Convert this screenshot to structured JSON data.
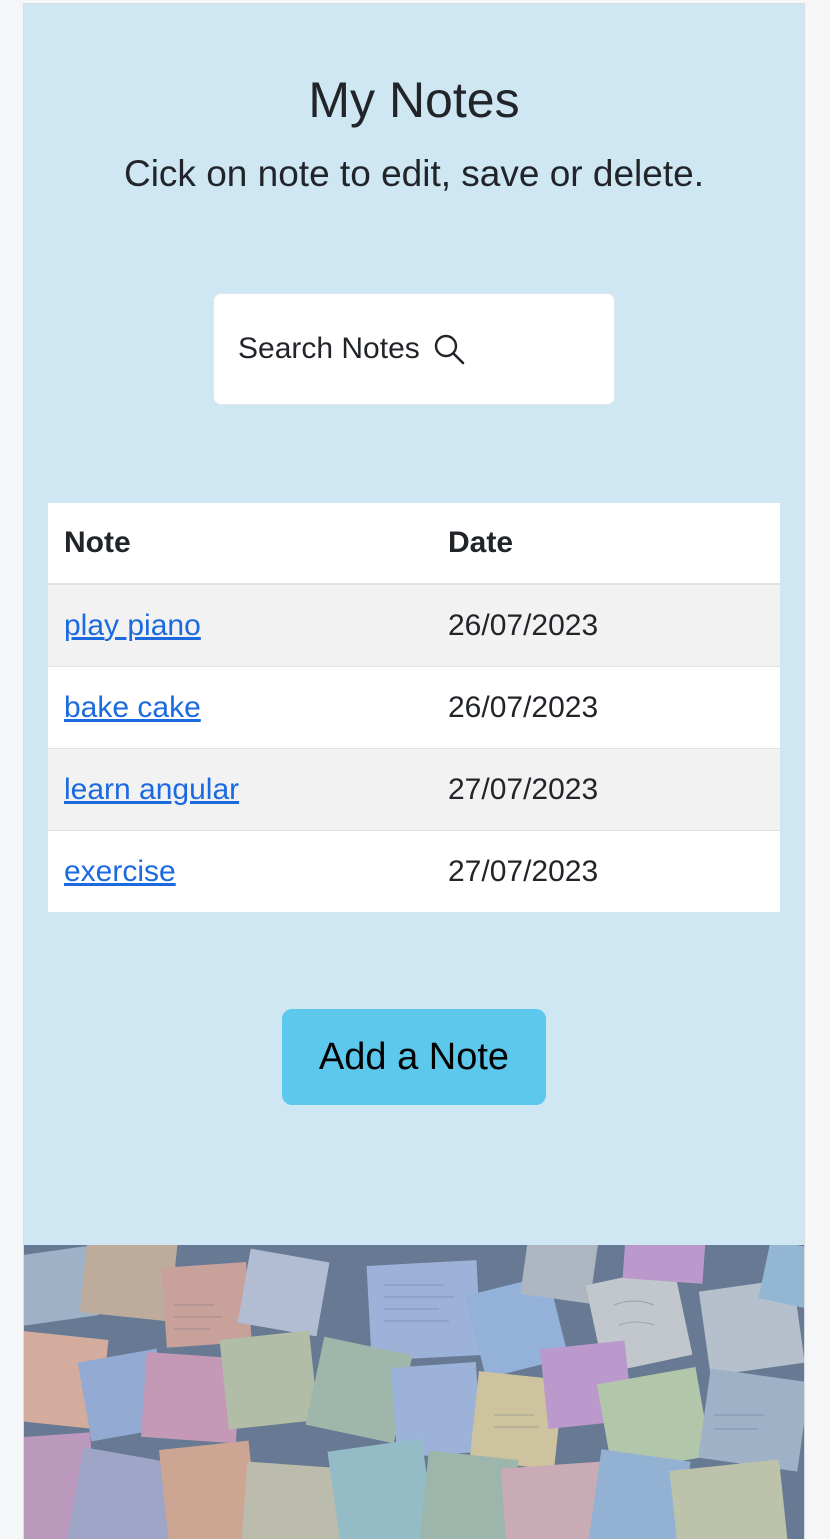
{
  "header": {
    "title": "My Notes",
    "subtitle": "Cick on note to edit, save or delete."
  },
  "search": {
    "label": "Search Notes",
    "icon": "search-icon"
  },
  "table": {
    "columns": [
      "Note",
      "Date"
    ],
    "rows": [
      {
        "note": "play piano",
        "date": "26/07/2023"
      },
      {
        "note": "bake cake",
        "date": "26/07/2023"
      },
      {
        "note": "learn angular",
        "date": "27/07/2023"
      },
      {
        "note": "exercise",
        "date": "27/07/2023"
      }
    ]
  },
  "actions": {
    "add_label": "Add a Note"
  },
  "colors": {
    "page_bg": "#cfe6f3",
    "link": "#1b6ae0",
    "button_bg": "#5bc8ec"
  },
  "banner": {
    "image": "sticky-notes-wall-image"
  }
}
